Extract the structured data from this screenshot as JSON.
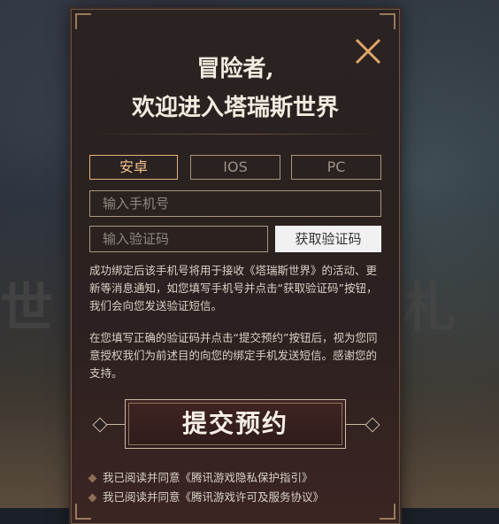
{
  "background": {
    "left_char": "世",
    "right_char": "札"
  },
  "modal": {
    "title_line1": "冒险者,",
    "title_line2": "欢迎进入塔瑞斯世界"
  },
  "tabs": [
    {
      "label": "安卓",
      "active": true
    },
    {
      "label": "IOS",
      "active": false
    },
    {
      "label": "PC",
      "active": false
    }
  ],
  "form": {
    "phone_placeholder": "输入手机号",
    "code_placeholder": "输入验证码",
    "get_code_label": "获取验证码"
  },
  "paragraphs": [
    "成功绑定后该手机号将用于接收《塔瑞斯世界》的活动、更新等消息通知，如您填写手机号并点击“获取验证码”按钮，我们会向您发送验证短信。",
    "在您填写正确的验证码并点击“提交预约”按钮后，视为您同意授权我们为前述目的向您的绑定手机发送短信。感谢您的支持。"
  ],
  "submit_label": "提交预约",
  "agreements": [
    "我已阅读并同意《腾讯游戏隐私保护指引》",
    "我已阅读并同意《腾讯游戏许可及服务协议》"
  ],
  "colors": {
    "accent": "#f2c08c",
    "border": "#a7957f"
  }
}
